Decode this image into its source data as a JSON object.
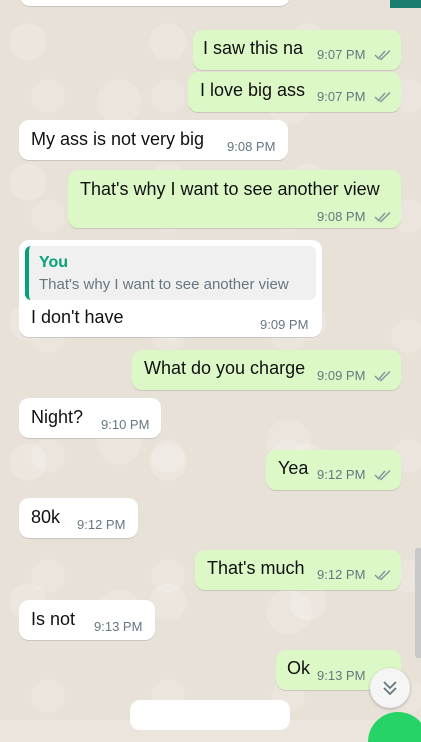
{
  "messages": [
    {
      "dir": "out",
      "text": "I saw this na",
      "time": "9:07 PM"
    },
    {
      "dir": "out",
      "text": "I love big ass",
      "time": "9:07 PM"
    },
    {
      "dir": "in",
      "text": "My ass is not very big",
      "time": "9:08 PM"
    },
    {
      "dir": "out",
      "text": "That's why I want to see another view",
      "time": "9:08 PM"
    },
    {
      "dir": "in",
      "quote_author": "You",
      "quote_text": "That's why I want to see another view",
      "text": "I don't have",
      "time": "9:09 PM"
    },
    {
      "dir": "out",
      "text": "What do you charge",
      "time": "9:09 PM"
    },
    {
      "dir": "in",
      "text": "Night?",
      "time": "9:10 PM"
    },
    {
      "dir": "out",
      "text": "Yea",
      "time": "9:12 PM"
    },
    {
      "dir": "in",
      "text": "80k",
      "time": "9:12 PM"
    },
    {
      "dir": "out",
      "text": "That's much",
      "time": "9:12 PM"
    },
    {
      "dir": "in",
      "text": "Is not",
      "time": "9:13 PM"
    },
    {
      "dir": "out",
      "text": "Ok",
      "time": "9:13 PM"
    }
  ],
  "colors": {
    "outgoing_bubble": "#dcf8c6",
    "incoming_bubble": "#ffffff",
    "read_ticks": "#8696a0",
    "quote_accent": "#06a276"
  },
  "icons": {
    "ticks": "double-check-icon",
    "scroll": "chevron-double-down-icon"
  }
}
